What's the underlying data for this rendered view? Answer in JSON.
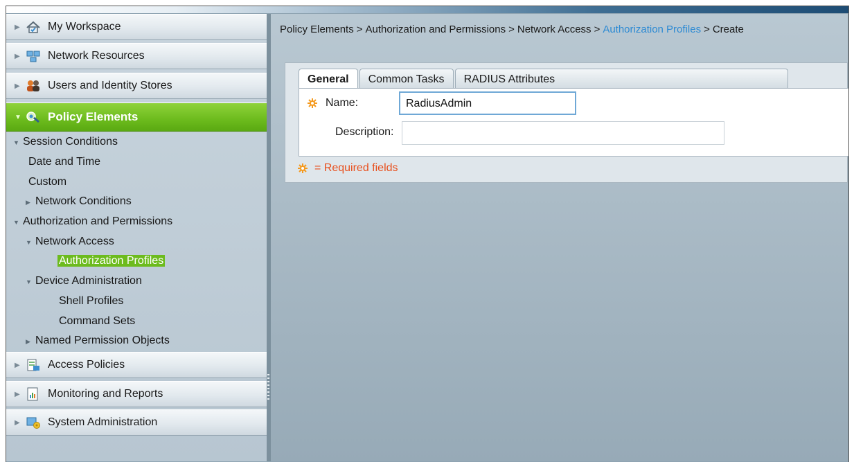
{
  "sidebar": {
    "drawers": [
      {
        "label": "My Workspace",
        "icon": "workspace-icon"
      },
      {
        "label": "Network Resources",
        "icon": "network-resources-icon"
      },
      {
        "label": "Users and Identity Stores",
        "icon": "users-icon"
      },
      {
        "label": "Policy Elements",
        "icon": "policy-elements-icon"
      },
      {
        "label": "Access Policies",
        "icon": "access-policies-icon"
      },
      {
        "label": "Monitoring and Reports",
        "icon": "monitoring-icon"
      },
      {
        "label": "System Administration",
        "icon": "system-admin-icon"
      }
    ],
    "tree": [
      {
        "label": "Session Conditions"
      },
      {
        "label": "Date and Time"
      },
      {
        "label": "Custom"
      },
      {
        "label": "Network Conditions"
      },
      {
        "label": "Authorization and Permissions"
      },
      {
        "label": "Network Access"
      },
      {
        "label": "Authorization Profiles"
      },
      {
        "label": "Device Administration"
      },
      {
        "label": "Shell Profiles"
      },
      {
        "label": "Command Sets"
      },
      {
        "label": "Named Permission Objects"
      }
    ],
    "accent_color": "#6cbb1d"
  },
  "breadcrumb": {
    "part1": "Policy Elements",
    "part2": "Authorization and Permissions",
    "part3": "Network Access",
    "part4": "Authorization Profiles",
    "part5": "Create",
    "separator": ">",
    "link_color": "#2d8ad3"
  },
  "tabs": [
    {
      "label": "General"
    },
    {
      "label": "Common Tasks"
    },
    {
      "label": "RADIUS Attributes"
    }
  ],
  "form": {
    "name_label": "Name:",
    "name_value": "RadiusAdmin",
    "description_label": "Description:",
    "description_value": "",
    "required_note": "= Required fields",
    "required_color": "#e8501e"
  }
}
